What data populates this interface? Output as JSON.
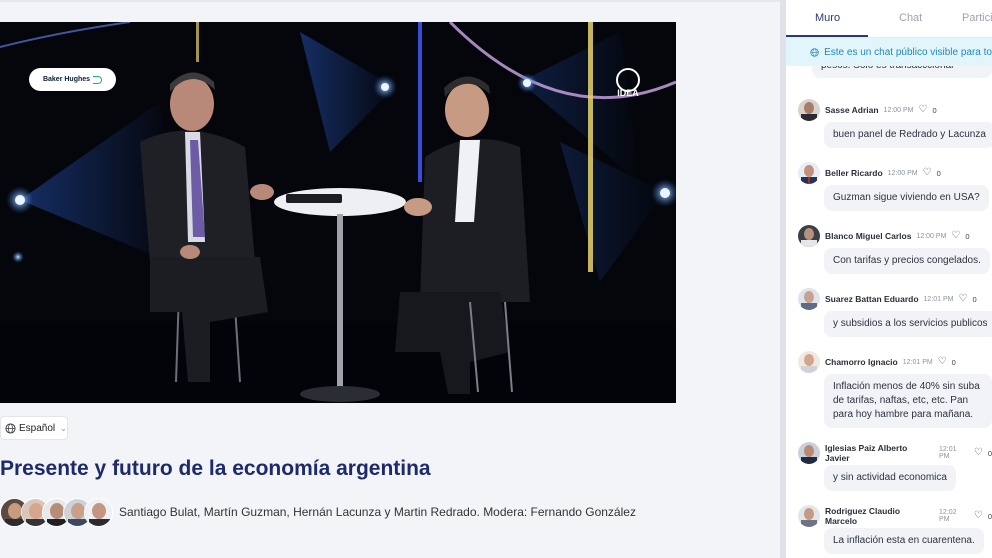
{
  "video": {
    "sponsor_label": "Baker Hughes",
    "channel_label": "IDEA"
  },
  "language": {
    "label": "Español"
  },
  "event": {
    "title": "Presente y futuro de la economía argentina",
    "speakers": "Santiago Bulat, Martín Guzman, Hernán Lacunza y Martin Redrado. Modera: Fernando González"
  },
  "chat": {
    "tabs": [
      "Muro",
      "Chat",
      "Partici"
    ],
    "notice": "Este es un chat público visible para to",
    "cut_message": "pesos. Solo es transacccional",
    "messages": [
      {
        "name": "Sasse Adrian",
        "time": "12:00 PM",
        "likes": "0",
        "text": "buen panel de Redrado y Lacunza"
      },
      {
        "name": "Beller Ricardo",
        "time": "12:00 PM",
        "likes": "0",
        "text": "Guzman sigue viviendo en USA?"
      },
      {
        "name": "Blanco Miguel Carlos",
        "time": "12:00 PM",
        "likes": "0",
        "text": "Con tarifas y precios congelados."
      },
      {
        "name": "Suarez Battan Eduardo",
        "time": "12:01 PM",
        "likes": "0",
        "text": "y subsidios a los servicios publicos"
      },
      {
        "name": "Chamorro Ignacio",
        "time": "12:01 PM",
        "likes": "0",
        "text": "Inflación menos de 40% sin suba de tarifas, naftas, etc, etc. Pan para hoy hambre para mañana."
      },
      {
        "name": "Iglesias Paiz Alberto Javier",
        "time": "12:01 PM",
        "likes": "0",
        "text": "y sin actividad economica"
      },
      {
        "name": "Rodriguez Claudio Marcelo",
        "time": "12:02 PM",
        "likes": "0",
        "text": "La inflación esta en cuarentena."
      }
    ]
  }
}
